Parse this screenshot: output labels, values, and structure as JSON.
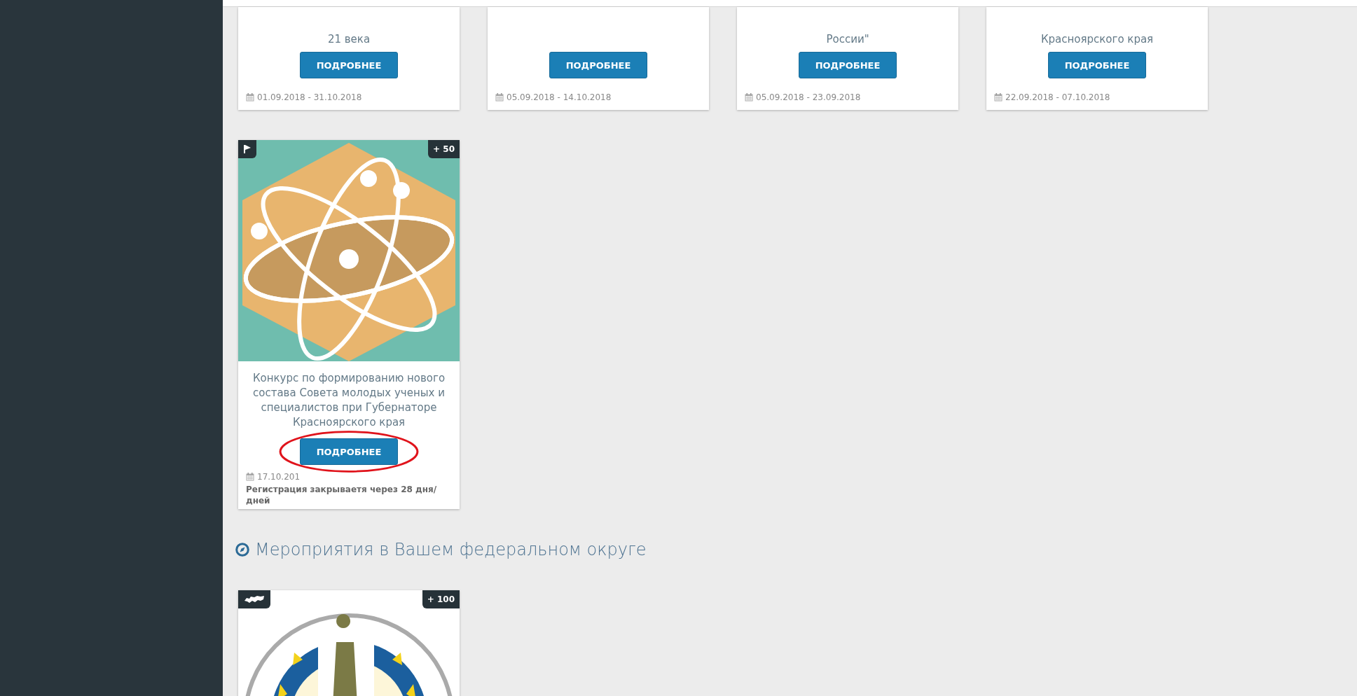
{
  "top_cards": [
    {
      "title_lines": [
        "21 века"
      ],
      "button": "ПОДРОБНЕЕ",
      "dates": "01.09.2018 - 31.10.2018"
    },
    {
      "button": "ПОДРОБНЕЕ",
      "dates": "05.09.2018 - 14.10.2018"
    },
    {
      "title_lines": [
        "России\""
      ],
      "button": "ПОДРОБНЕЕ",
      "dates": "05.09.2018 - 23.09.2018"
    },
    {
      "title_lines": [
        "Красноярского края"
      ],
      "button": "ПОДРОБНЕЕ",
      "dates": "22.09.2018 - 07.10.2018"
    }
  ],
  "featured_card": {
    "points": "+ 50",
    "title": "Конкурс по формированию нового состава Совета молодых ученых и специалистов при Губернаторе Красноярского края",
    "button": "ПОДРОБНЕЕ",
    "highlighted": true,
    "dates": "17.10.201",
    "registration": "Регистрация закрываетя через 28 дня/ дней"
  },
  "section": {
    "title": "Мероприятия в Вашем федеральном округе"
  },
  "region_card": {
    "points": "+ 100"
  }
}
